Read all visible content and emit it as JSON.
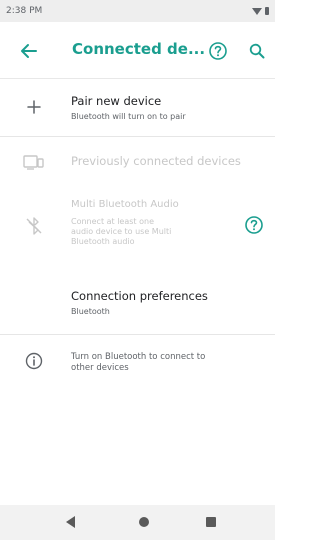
{
  "status_bar": {
    "time": "2:38 PM"
  },
  "app_bar": {
    "title": "Connected de...",
    "back_icon": "arrow-back-icon",
    "help_icon": "help-icon",
    "search_icon": "search-icon"
  },
  "items": [
    {
      "title": "Pair new device",
      "subtitle": "Bluetooth will turn on to pair",
      "icon": "plus-icon"
    },
    {
      "title": "Previously connected devices",
      "icon": "devices-icon"
    },
    {
      "title": "Multi Bluetooth Audio",
      "subtitle_lines": [
        "Connect at least one",
        "audio device to use Multi",
        "Bluetooth audio"
      ],
      "icon": "bluetooth-off-icon",
      "help_icon": "help-icon"
    },
    {
      "title": "Connection preferences",
      "subtitle": "Bluetooth"
    },
    {
      "info_lines": [
        "Turn on Bluetooth to connect to",
        "other devices"
      ],
      "icon": "info-icon"
    }
  ],
  "colors": {
    "accent": "#1a9e8f",
    "disabled": "#c7c7c7"
  }
}
